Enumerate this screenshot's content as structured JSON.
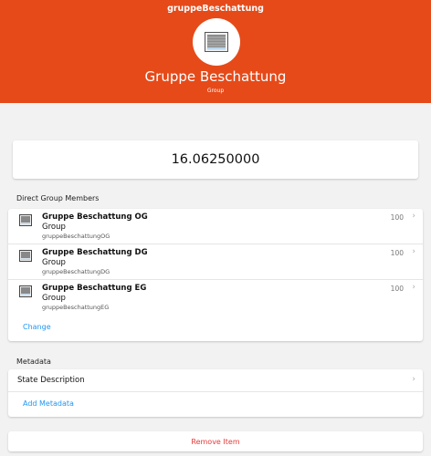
{
  "navbar": {
    "title": "gruppeBeschattung"
  },
  "hero": {
    "title": "Gruppe Beschattung",
    "subtitle": "Group",
    "icon": "rollershutter-icon"
  },
  "state": {
    "value": "16.06250000"
  },
  "members": {
    "heading": "Direct Group Members",
    "items": [
      {
        "label": "Gruppe Beschattung OG",
        "type": "Group",
        "name": "gruppeBeschattungOG",
        "state": "100"
      },
      {
        "label": "Gruppe Beschattung DG",
        "type": "Group",
        "name": "gruppeBeschattungDG",
        "state": "100"
      },
      {
        "label": "Gruppe Beschattung EG",
        "type": "Group",
        "name": "gruppeBeschattungEG",
        "state": "100"
      }
    ],
    "change_label": "Change"
  },
  "metadata": {
    "heading": "Metadata",
    "state_description": "State Description",
    "add_label": "Add Metadata"
  },
  "actions": {
    "remove_label": "Remove Item"
  },
  "colors": {
    "header": "#e64a19",
    "link": "#2196f3",
    "danger": "#e53935"
  }
}
